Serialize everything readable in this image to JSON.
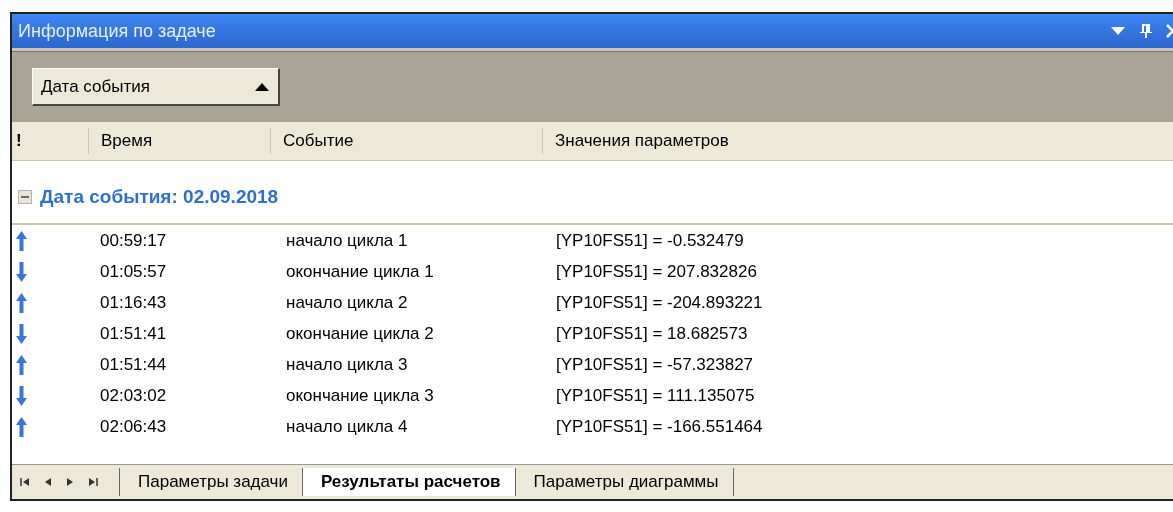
{
  "window": {
    "title": "Информация по задаче"
  },
  "group_by": {
    "label": "Дата события",
    "ascending": true
  },
  "table": {
    "columns": [
      "!",
      "Время",
      "Событие",
      "Значения параметров"
    ],
    "group": {
      "label": "Дата события: 02.09.2018",
      "expanded": true
    },
    "rows": [
      {
        "kind": "up",
        "time": "00:59:17",
        "event": "начало цикла 1",
        "value": "[YP10FS51] = -0.532479"
      },
      {
        "kind": "down",
        "time": "01:05:57",
        "event": "окончание цикла 1",
        "value": "[YP10FS51] = 207.832826"
      },
      {
        "kind": "up",
        "time": "01:16:43",
        "event": "начало цикла 2",
        "value": "[YP10FS51] = -204.893221"
      },
      {
        "kind": "down",
        "time": "01:51:41",
        "event": "окончание цикла 2",
        "value": "[YP10FS51] = 18.682573"
      },
      {
        "kind": "up",
        "time": "01:51:44",
        "event": "начало цикла 3",
        "value": "[YP10FS51] = -57.323827"
      },
      {
        "kind": "down",
        "time": "02:03:02",
        "event": "окончание цикла 3",
        "value": "[YP10FS51] = 111.135075"
      },
      {
        "kind": "up",
        "time": "02:06:43",
        "event": "начало цикла 4",
        "value": "[YP10FS51] = -166.551464"
      }
    ]
  },
  "tabs": [
    {
      "label": "Параметры задачи",
      "selected": false
    },
    {
      "label": "Результаты расчетов",
      "selected": true
    },
    {
      "label": "Параметры диаграммы",
      "selected": false
    }
  ]
}
